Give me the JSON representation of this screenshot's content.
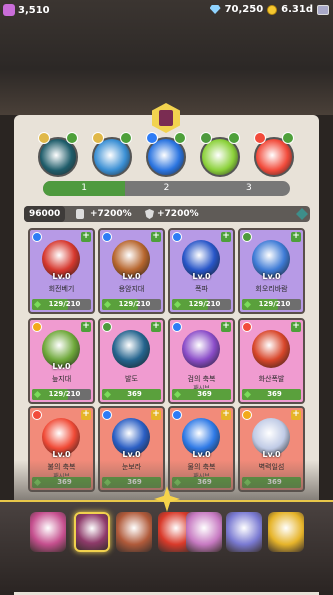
{
  "hud": {
    "flags": "3,510",
    "gems": "70,250",
    "gold": "6.31d"
  },
  "equipped": [
    {
      "name": "deer-spirit",
      "color": "#1f5d6b",
      "elem": "#e0b848"
    },
    {
      "name": "lightning-orb",
      "color": "#3a8fd4",
      "elem": "#e0b848"
    },
    {
      "name": "water-vortex",
      "color": "#2a74e0",
      "elem": "#2e7cf5"
    },
    {
      "name": "leaf-swirl",
      "color": "#8bd13a",
      "elem": "#4e9a3e"
    },
    {
      "name": "fire-swirl",
      "color": "#f24b3b",
      "elem": "#f24b3b"
    }
  ],
  "tabs": [
    "1",
    "2",
    "3"
  ],
  "stats": {
    "points": "96000",
    "bonus1": "+7200%",
    "bonus2": "+7200%"
  },
  "cards": [
    {
      "name": "회전베기",
      "lv": "Lv.0",
      "sub": "",
      "count": "129/210",
      "fill": 0.61,
      "bg": "#b79ae6",
      "icon": "#d6382e",
      "elem": "#2e7cf5",
      "plus": "#4ea03a"
    },
    {
      "name": "용암지대",
      "lv": "Lv.0",
      "sub": "",
      "count": "129/210",
      "fill": 0.61,
      "bg": "#b79ae6",
      "icon": "#b7662e",
      "elem": "#2e7cf5",
      "plus": "#4ea03a"
    },
    {
      "name": "폭파",
      "lv": "Lv.0",
      "sub": "",
      "count": "129/210",
      "fill": 0.61,
      "bg": "#b79ae6",
      "icon": "#2856c8",
      "elem": "#2e7cf5",
      "plus": "#4ea03a"
    },
    {
      "name": "회오리바람",
      "lv": "Lv.0",
      "sub": "",
      "count": "129/210",
      "fill": 0.61,
      "bg": "#b79ae6",
      "icon": "#3e7bd6",
      "elem": "#4e9a3e",
      "plus": "#4ea03a"
    },
    {
      "name": "늪지대",
      "lv": "Lv.0",
      "sub": "",
      "count": "129/210",
      "fill": 0.61,
      "bg": "#f09bd0",
      "icon": "#6ea83a",
      "elem": "#f2a91b",
      "plus": "#4ea03a"
    },
    {
      "name": "발도",
      "lv": "",
      "sub": "",
      "count": "369",
      "fill": 1,
      "bg": "#f09bd0",
      "icon": "#24648e",
      "elem": "#4e9a3e",
      "plus": "#4ea03a"
    },
    {
      "name": "검의 축복",
      "lv": "",
      "sub": "패시브",
      "count": "369",
      "fill": 1,
      "bg": "#f09bd0",
      "icon": "#8a4cc8",
      "elem": "#2e7cf5",
      "plus": "#4ea03a"
    },
    {
      "name": "화산폭발",
      "lv": "",
      "sub": "",
      "count": "369",
      "fill": 1,
      "bg": "#f09bd0",
      "icon": "#d8462a",
      "elem": "#f24b3b",
      "plus": "#4ea03a"
    },
    {
      "name": "불의 축복",
      "lv": "Lv.0",
      "sub": "패시브",
      "count": "369",
      "fill": 1,
      "bg": "#f28b7a",
      "icon": "#f04a36",
      "elem": "#f24b3b",
      "plus": "#e6b42a"
    },
    {
      "name": "눈보라",
      "lv": "Lv.0",
      "sub": "",
      "count": "369",
      "fill": 1,
      "bg": "#f28b7a",
      "icon": "#2b5fc4",
      "elem": "#2e7cf5",
      "plus": "#e6b42a"
    },
    {
      "name": "물의 축복",
      "lv": "Lv.0",
      "sub": "패시브",
      "count": "369",
      "fill": 1,
      "bg": "#f28b7a",
      "icon": "#2f7ae6",
      "elem": "#2e7cf5",
      "plus": "#e6b42a"
    },
    {
      "name": "벽력일섬",
      "lv": "Lv.0",
      "sub": "",
      "count": "369",
      "fill": 1,
      "bg": "#f28b7a",
      "icon": "#c0cbe6",
      "elem": "#f2a91b",
      "plus": "#e6b42a"
    }
  ],
  "nav": [
    {
      "name": "nav-treasure",
      "color": "#c54f8e"
    },
    {
      "name": "nav-skills",
      "color": "#8e3a6a"
    },
    {
      "name": "nav-sword",
      "color": "#b05a3a"
    },
    {
      "name": "nav-battle",
      "color": "#d93a2a"
    },
    {
      "name": "nav-chest",
      "color": "#c77ac2"
    },
    {
      "name": "nav-warrior",
      "color": "#7a7ad2"
    },
    {
      "name": "nav-shop",
      "color": "#e6b42a"
    }
  ]
}
